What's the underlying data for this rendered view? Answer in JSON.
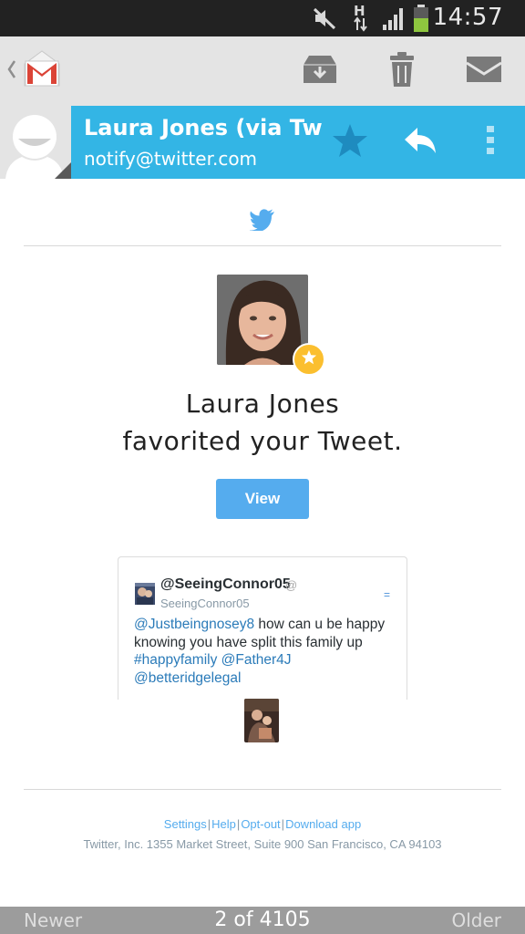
{
  "status_bar": {
    "time": "14:57",
    "network_label": "H",
    "icons": [
      "muted-icon",
      "network-h-icon",
      "signal-icon",
      "battery-icon"
    ]
  },
  "action_bar": {
    "app_icon": "gmail-icon",
    "actions": [
      "archive-icon",
      "delete-icon",
      "mark-unread-icon"
    ]
  },
  "message_header": {
    "sender_name": "Laura Jones (via Tw…",
    "sender_email": "notify@twitter.com",
    "actions": [
      "star-icon",
      "reply-icon",
      "overflow-menu-icon"
    ]
  },
  "email": {
    "logo": "twitter-bird-icon",
    "headline_line1": "Laura Jones",
    "headline_line2": "favorited your Tweet.",
    "view_button": "View",
    "tweet": {
      "handle": "@SeeingConnor05",
      "at_symbol": "@",
      "sub_handle": "SeeingConnor05",
      "menu_glyph": "=",
      "text_parts": [
        {
          "text": "@Justbeingnosey8",
          "link": true
        },
        {
          "text": " how can u be happy knowing you have split this family up ",
          "link": false
        },
        {
          "text": "#happyfamily",
          "link": true
        },
        {
          "text": " ",
          "link": false
        },
        {
          "text": "@Father4J",
          "link": true
        },
        {
          "text": " ",
          "link": false
        },
        {
          "text": "@betteridgelegal",
          "link": true
        }
      ]
    },
    "footer_links": [
      "Settings",
      "Help",
      "Opt-out",
      "Download app"
    ],
    "footer_separator": "|",
    "footer_address": "Twitter, Inc. 1355 Market Street, Suite 900 San Francisco, CA 94103"
  },
  "navigation": {
    "newer": "Newer",
    "position": "2 of 4105",
    "older": "Older"
  },
  "colors": {
    "header_blue": "#33b5e5",
    "twitter_blue": "#55acee",
    "link_blue": "#2b7bb9",
    "gmail_red": "#db4437",
    "star_yellow": "#fbbf2f"
  }
}
